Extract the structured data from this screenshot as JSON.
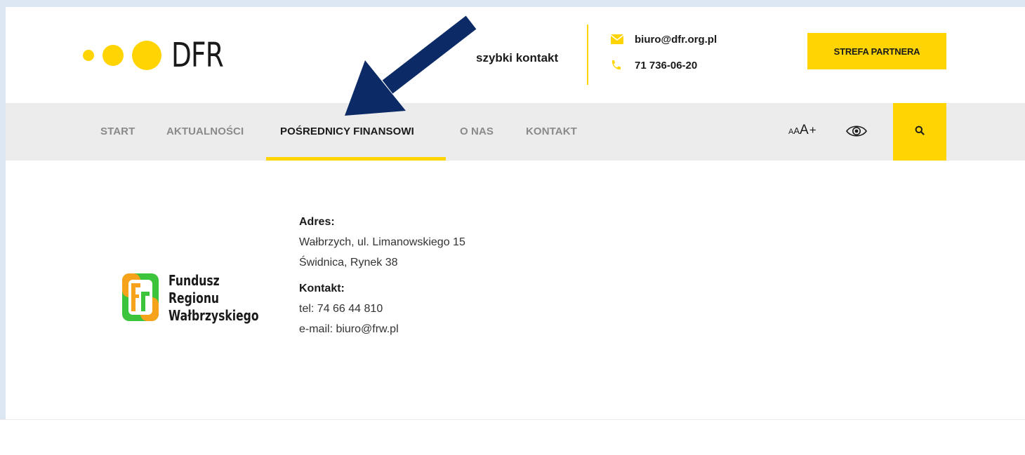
{
  "header": {
    "logo_text": "DFR",
    "quick_contact_label": "szybki kontakt",
    "email": "biuro@dfr.org.pl",
    "phone": "71 736-06-20",
    "partner_button": "STREFA PARTNERA"
  },
  "nav": {
    "items": [
      {
        "label": "START"
      },
      {
        "label": "AKTUALNOŚCI"
      },
      {
        "label": "POŚREDNICY FINANSOWI"
      },
      {
        "label": "O NAS"
      },
      {
        "label": "KONTAKT"
      }
    ],
    "active_index": 2,
    "font_size_control": {
      "a1": "A",
      "a2": "A",
      "a3": "A",
      "plus": "+"
    }
  },
  "partner": {
    "logo_lines": [
      "Fundusz",
      "Regionu",
      "Wałbrzyskiego"
    ],
    "address_heading": "Adres:",
    "address_lines": [
      "Wałbrzych, ul. Limanowskiego 15",
      "Świdnica, Rynek 38"
    ],
    "contact_heading": "Kontakt:",
    "tel": "tel: 74 66 44 810",
    "email": "e-mail: biuro@frw.pl"
  },
  "icons": {
    "email": "envelope-icon",
    "phone": "phone-icon",
    "contrast": "eye-icon",
    "search": "search-icon",
    "annotation": "arrow-annotation"
  },
  "colors": {
    "accent": "#ffd400",
    "nav_bg": "#ececec",
    "arrow": "#0b2a66",
    "frw_orange": "#f7a21b",
    "frw_green": "#3cc43c"
  }
}
